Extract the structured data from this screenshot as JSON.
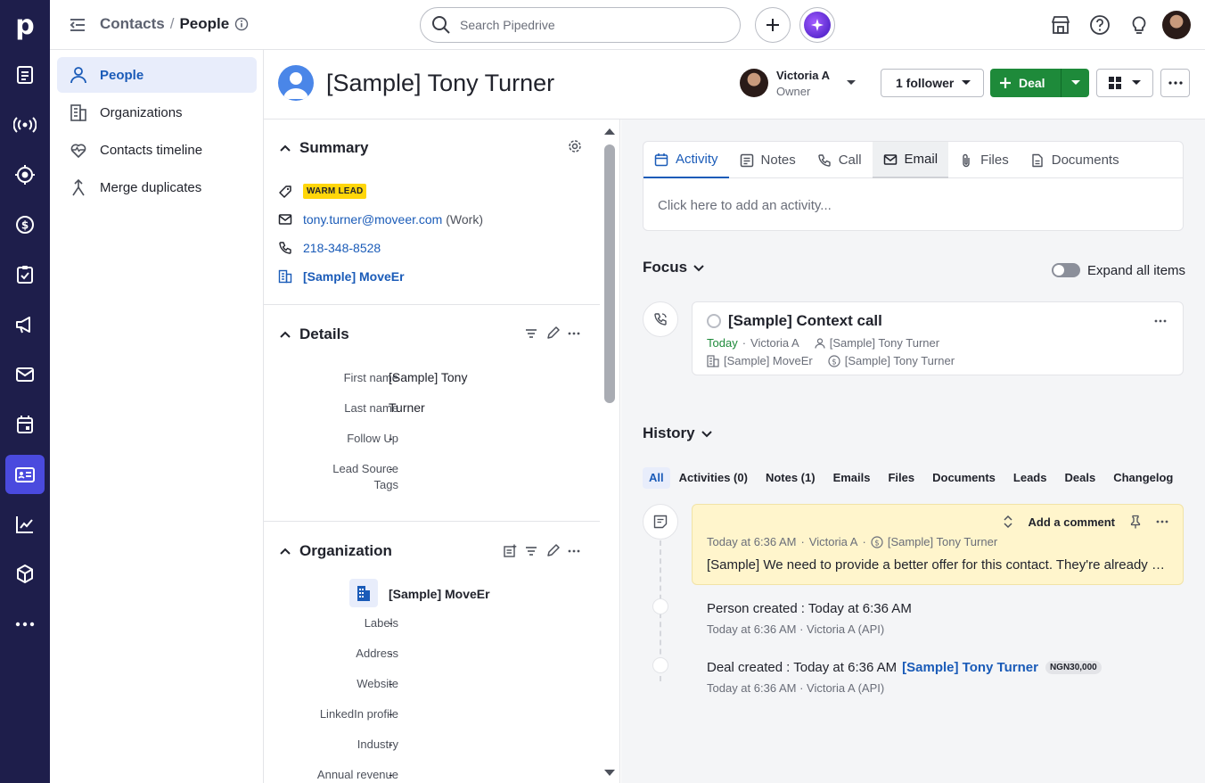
{
  "brand": {
    "logo_letter": "p"
  },
  "rail": {
    "items": [
      "leads-icon",
      "broadcast-icon",
      "target-icon",
      "deals-icon",
      "tasks-icon",
      "campaigns-icon",
      "mail-icon",
      "calendar-icon",
      "contacts-icon",
      "insights-icon",
      "products-icon",
      "more-icon"
    ],
    "active": "contacts-icon"
  },
  "topbar": {
    "breadcrumb_parent": "Contacts",
    "breadcrumb_sep": "/",
    "breadcrumb_current": "People",
    "search_placeholder": "Search Pipedrive"
  },
  "sidebar": {
    "items": [
      {
        "label": "People",
        "icon": "person-icon"
      },
      {
        "label": "Organizations",
        "icon": "building-icon"
      },
      {
        "label": "Contacts timeline",
        "icon": "heart-pulse-icon"
      },
      {
        "label": "Merge duplicates",
        "icon": "merge-icon"
      }
    ]
  },
  "header": {
    "name": "[Sample] Tony Turner",
    "owner_name": "Victoria A",
    "owner_role": "Owner",
    "follower_label": "1 follower",
    "deal_label": "Deal"
  },
  "summary": {
    "title": "Summary",
    "label_badge": "WARM LEAD",
    "email": "tony.turner@moveer.com",
    "email_type": "(Work)",
    "phone": "218-348-8528",
    "organization": "[Sample] MoveEr"
  },
  "details": {
    "title": "Details",
    "fields": [
      {
        "label": "First name",
        "value": "[Sample] Tony"
      },
      {
        "label": "Last name",
        "value": "Turner"
      },
      {
        "label": "Follow Up",
        "value": "-"
      },
      {
        "label": "Lead Source",
        "label2": "Tags",
        "value": "-"
      }
    ]
  },
  "organization": {
    "title": "Organization",
    "name": "[Sample] MoveEr",
    "fields": [
      {
        "label": "Labels",
        "value": "-"
      },
      {
        "label": "Address",
        "value": "-"
      },
      {
        "label": "Website",
        "value": "-"
      },
      {
        "label": "LinkedIn profile",
        "value": "-"
      },
      {
        "label": "Industry",
        "value": "-"
      },
      {
        "label": "Annual revenue",
        "value": "-"
      }
    ]
  },
  "composer": {
    "tabs": [
      "Activity",
      "Notes",
      "Call",
      "Email",
      "Files",
      "Documents"
    ],
    "active_tab": "Activity",
    "hint": "Click here to add an activity..."
  },
  "focus": {
    "title": "Focus",
    "expand_label": "Expand all items",
    "activity": {
      "title": "[Sample] Context call",
      "date": "Today",
      "owner": "Victoria A",
      "person": "[Sample] Tony Turner",
      "org": "[Sample] MoveEr",
      "deal": "[Sample] Tony Turner"
    }
  },
  "history": {
    "title": "History",
    "filters": [
      "All",
      "Activities (0)",
      "Notes (1)",
      "Emails",
      "Files",
      "Documents",
      "Leads",
      "Deals",
      "Changelog"
    ],
    "active_filter": "All",
    "note": {
      "add_comment": "Add a comment",
      "time": "Today at 6:36 AM",
      "author": "Victoria A",
      "deal": "[Sample] Tony Turner",
      "text": "[Sample] We need to provide a better offer for this contact. They're already using a competitor product."
    },
    "events": [
      {
        "label": "Person created",
        "value": "Today at 6:36 AM",
        "sub": "Today at 6:36 AM · Victoria A (API)"
      },
      {
        "label": "Deal created",
        "value": "Today at 6:36 AM",
        "link": "[Sample] Tony Turner",
        "amount": "NGN30,000",
        "sub": "Today at 6:36 AM · Victoria A (API)"
      }
    ]
  },
  "colors": {
    "rail_bg": "#1e1e4b",
    "rail_active": "#4a4ade",
    "accent_blue": "#1a5bb8",
    "deal_green": "#1e8a3a",
    "warm_lead": "#ffd60a",
    "note_bg": "#fff5cc"
  }
}
